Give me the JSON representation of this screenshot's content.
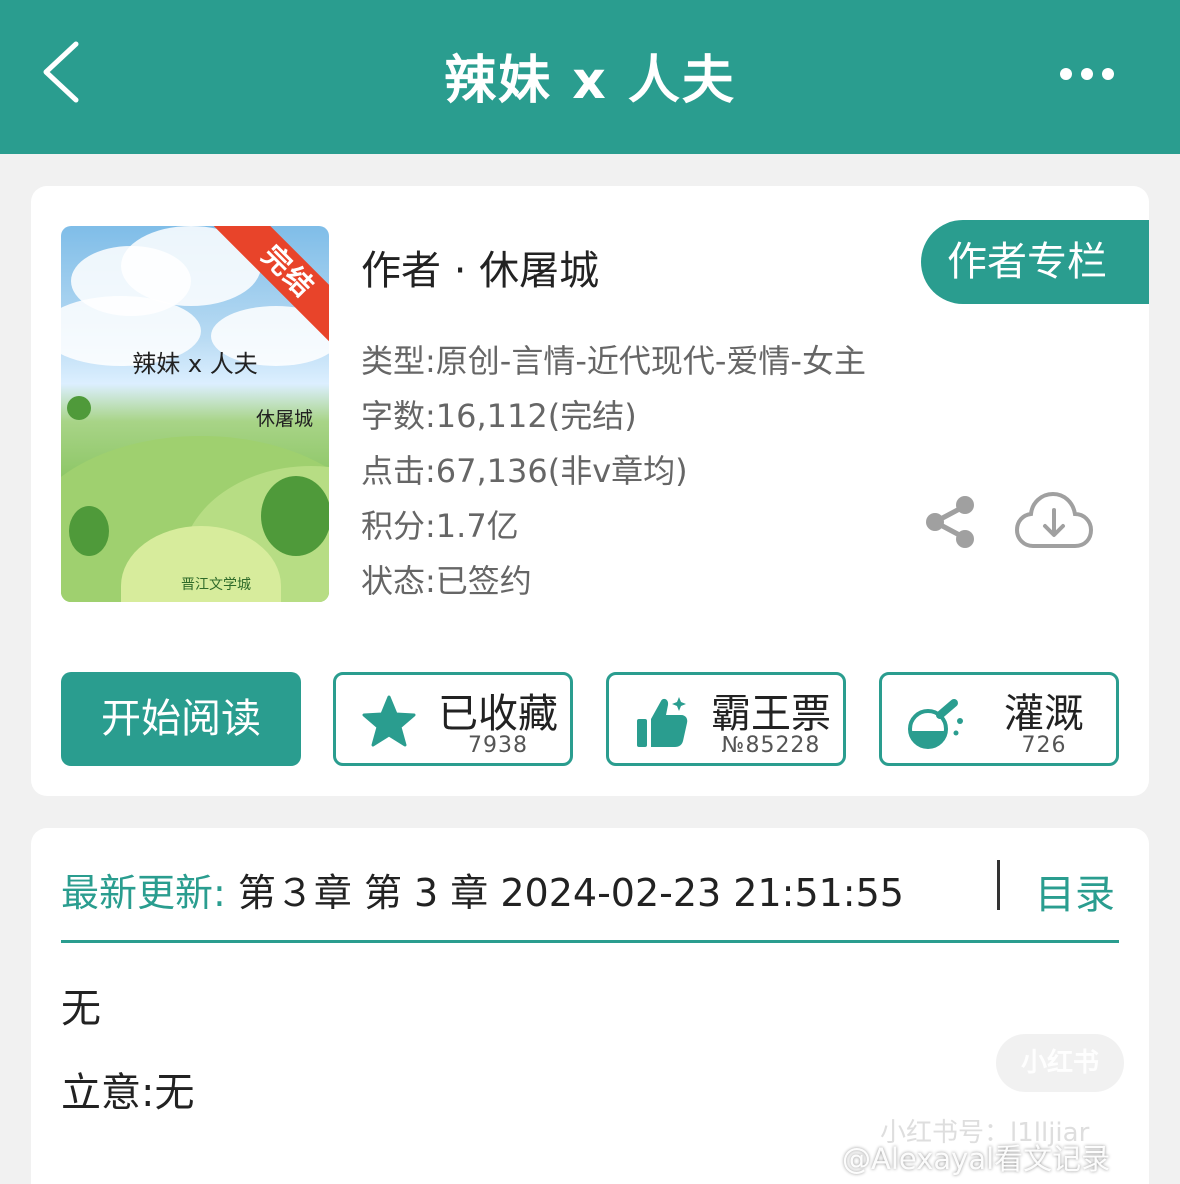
{
  "header": {
    "title": "辣妹 x 人夫",
    "back_icon": "chevron-left-icon",
    "more_icon": "more-horizontal-icon"
  },
  "cover": {
    "title": "辣妹 x 人夫",
    "author": "休屠城",
    "ribbon": "完结",
    "logo": "晋江文学城"
  },
  "book_info": {
    "author_line": "作者 · 休屠城",
    "author_column_label": "作者专栏",
    "type": "类型:原创-言情-近代现代-爱情-女主",
    "word_count": "字数:16,112(完结)",
    "clicks": "点击:67,136(非v章均)",
    "points": "积分:1.7亿",
    "status": "状态:已签约",
    "share_icon": "share-icon",
    "download_icon": "cloud-download-icon"
  },
  "actions": {
    "start_reading": "开始阅读",
    "favorite": {
      "label": "已收藏",
      "count": "7938",
      "icon": "star-icon"
    },
    "tickets": {
      "label": "霸王票",
      "count": "№85228",
      "icon": "thumbs-up-icon"
    },
    "watering": {
      "label": "灌溉",
      "count": "726",
      "icon": "watering-flask-icon"
    }
  },
  "update": {
    "label": "最新更新:",
    "value": " 第３章 第 3 章 2024-02-23 21:51:55",
    "catalog": "目录"
  },
  "description": {
    "summary": "无",
    "theme": "立意:无"
  },
  "watermark": {
    "badge": "小红书",
    "id": "小红书号：l1lljiar",
    "weibo": "@Alexayal看文记录"
  },
  "colors": {
    "accent": "#2a9d8f",
    "ribbon": "#e8442a",
    "background": "#f1f1f1"
  }
}
